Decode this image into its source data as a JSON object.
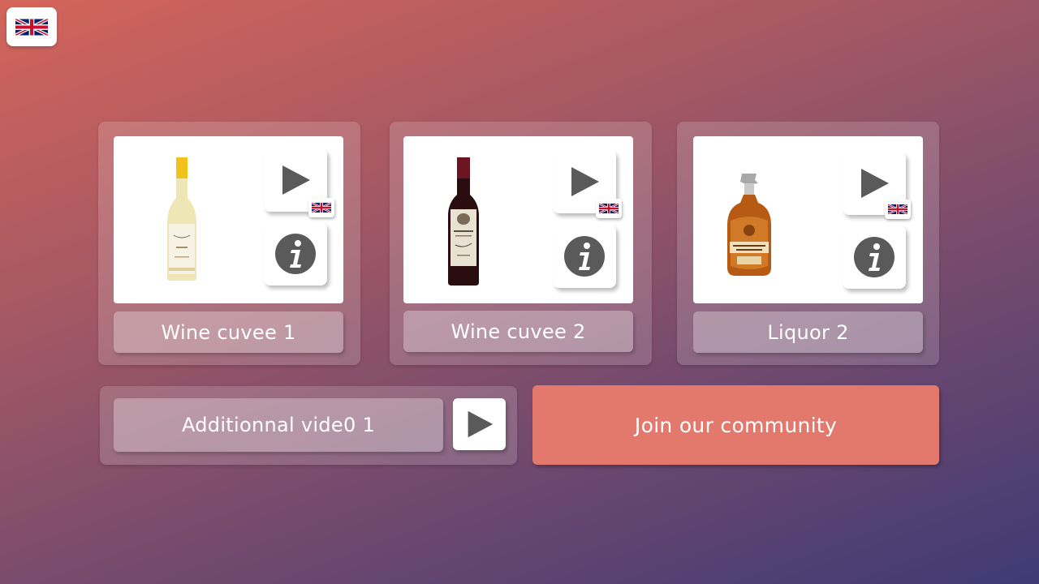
{
  "language": {
    "icon": "uk-flag-icon"
  },
  "products": [
    {
      "name": "Wine cuvee 1",
      "bottle": "white-wine-bottle",
      "play_icon": "play-icon",
      "info_icon": "info-icon",
      "lang_icon": "uk-flag-icon"
    },
    {
      "name": "Wine cuvee 2",
      "bottle": "red-wine-bottle",
      "play_icon": "play-icon",
      "info_icon": "info-icon",
      "lang_icon": "uk-flag-icon"
    },
    {
      "name": "Liquor 2",
      "bottle": "liquor-bottle",
      "play_icon": "play-icon",
      "info_icon": "info-icon",
      "lang_icon": "uk-flag-icon"
    }
  ],
  "additional_video": {
    "label": "Additionnal vide0 1",
    "play_icon": "play-icon"
  },
  "community": {
    "label": "Join our community"
  },
  "colors": {
    "accent": "#e3786c",
    "icon_gray": "#5a5a5a"
  }
}
